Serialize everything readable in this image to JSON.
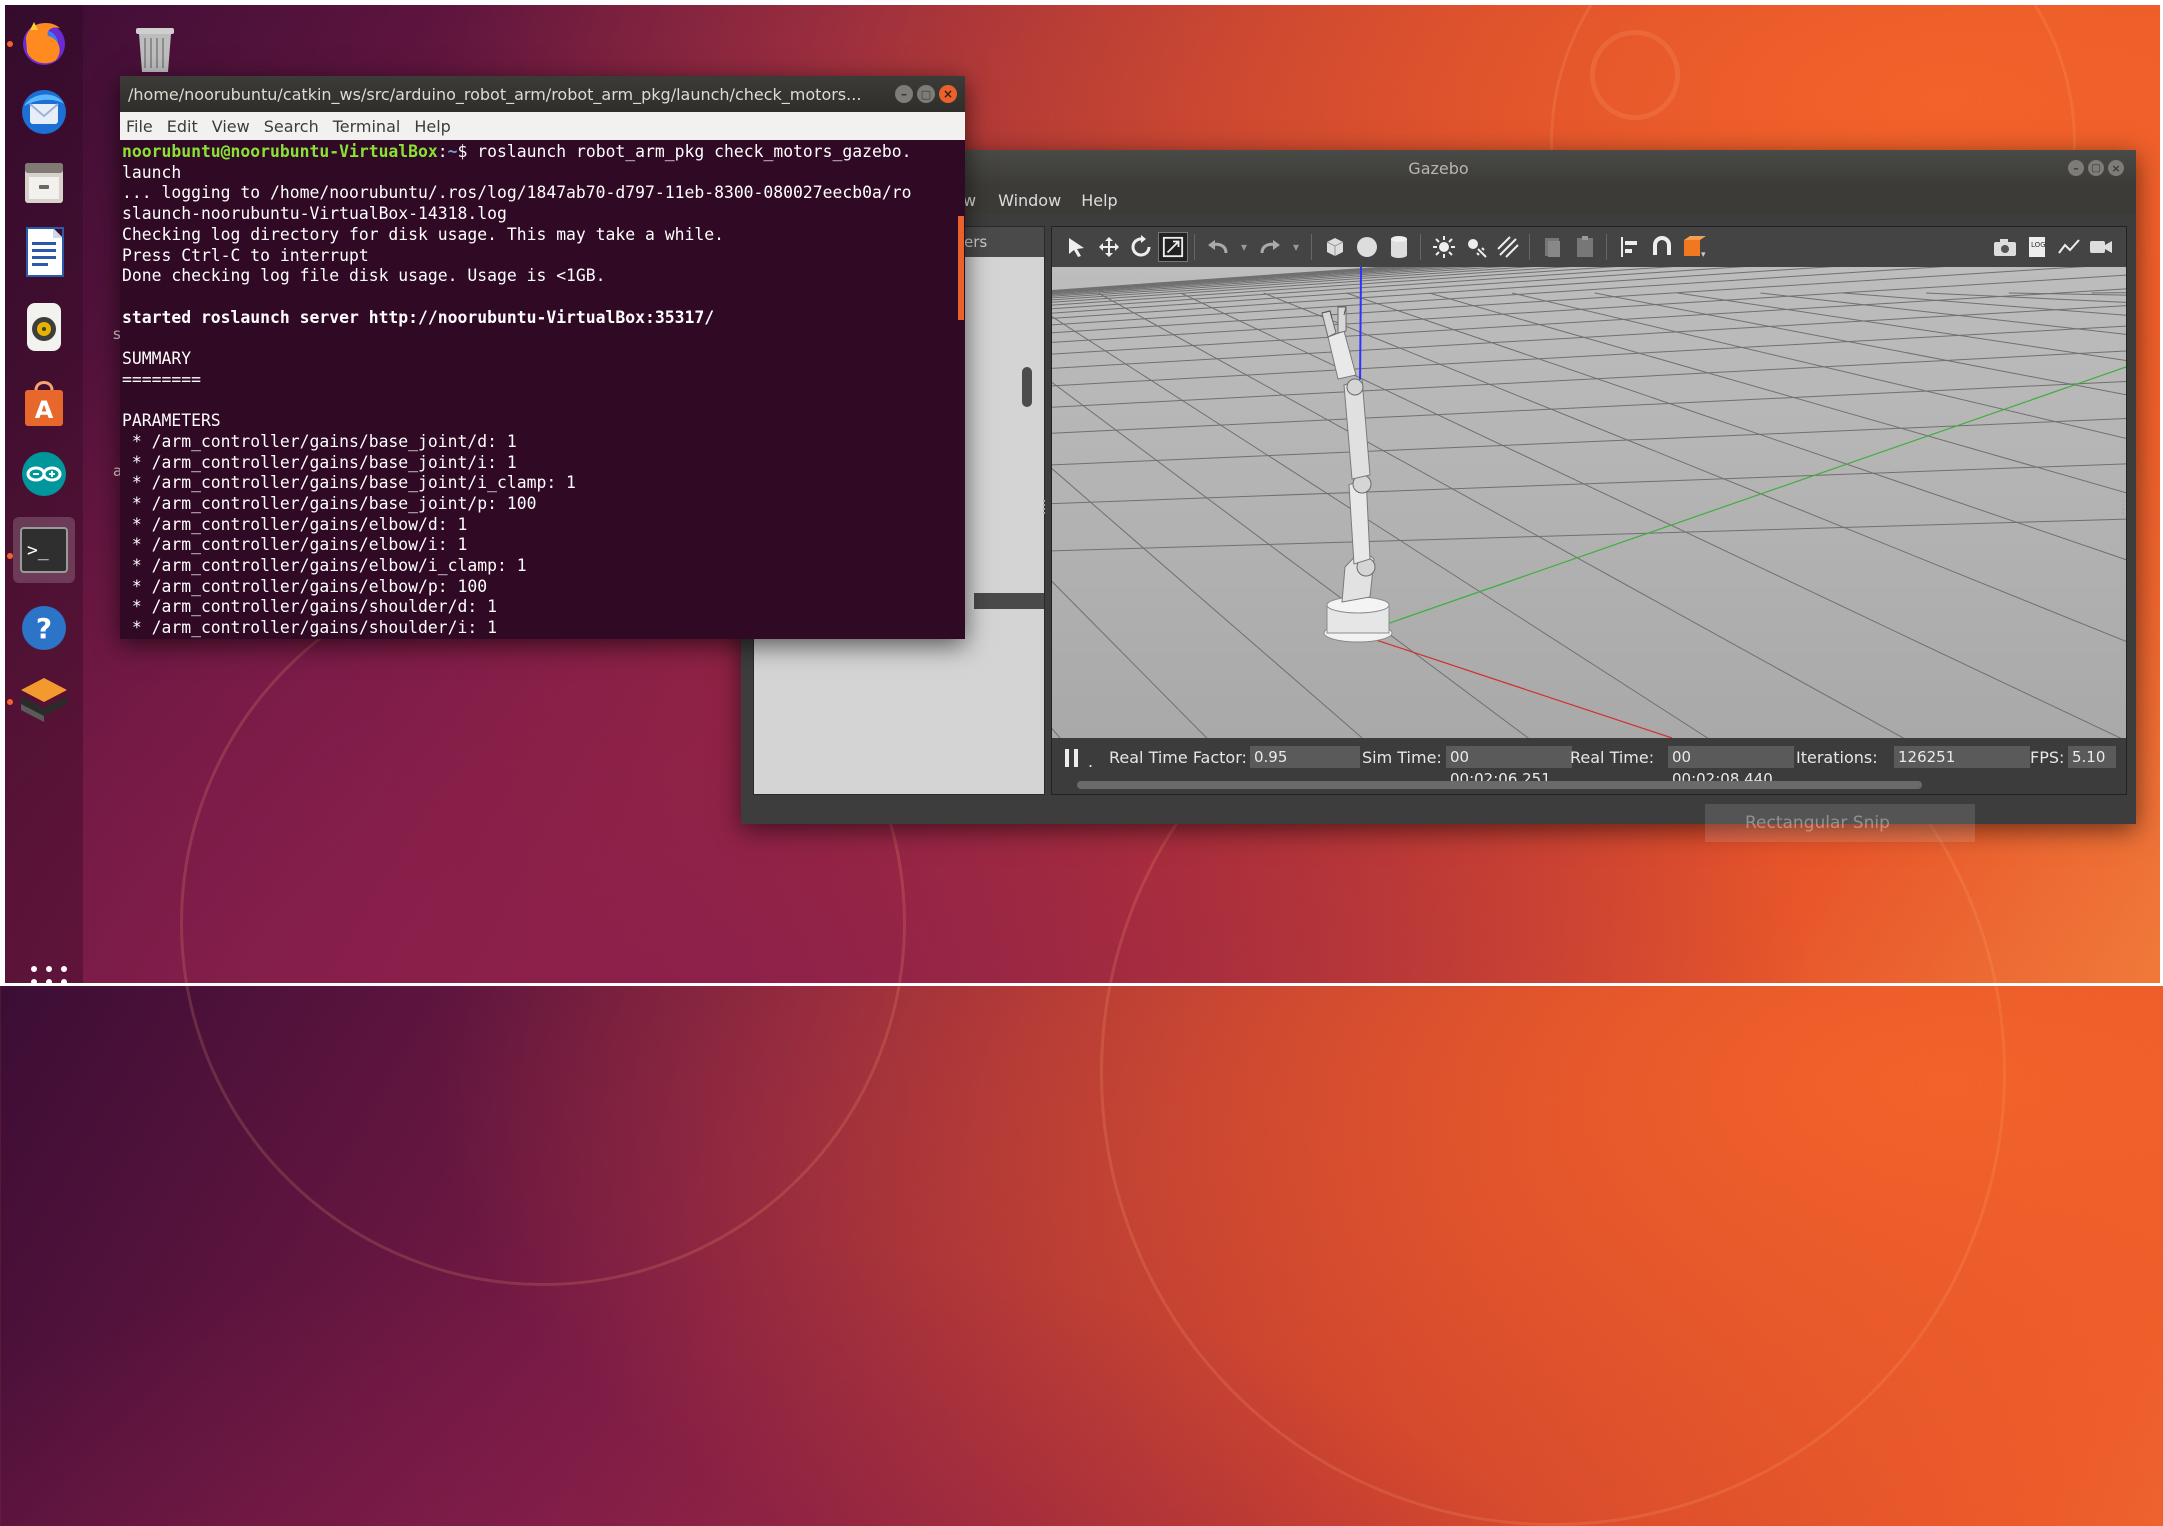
{
  "desktop": {
    "snip_label": "Rectangular Snip",
    "desktop_letters": [
      "s",
      "a"
    ]
  },
  "dock": {
    "items": [
      {
        "name": "Firefox",
        "icon": "firefox-icon"
      },
      {
        "name": "Thunderbird",
        "icon": "thunderbird-icon"
      },
      {
        "name": "Files",
        "icon": "files-icon"
      },
      {
        "name": "LibreOffice Writer",
        "icon": "writer-icon"
      },
      {
        "name": "Rhythmbox",
        "icon": "rhythmbox-icon"
      },
      {
        "name": "Ubuntu Software",
        "icon": "software-icon"
      },
      {
        "name": "Arduino",
        "icon": "arduino-icon"
      },
      {
        "name": "Terminal",
        "icon": "terminal-icon"
      },
      {
        "name": "Help",
        "icon": "help-icon"
      },
      {
        "name": "Gazebo",
        "icon": "gazebo-icon"
      }
    ]
  },
  "terminal": {
    "title": "/home/noorubuntu/catkin_ws/src/arduino_robot_arm/robot_arm_pkg/launch/check_motors...",
    "menu": [
      "File",
      "Edit",
      "View",
      "Search",
      "Terminal",
      "Help"
    ],
    "prompt_user": "noorubuntu@noorubuntu-VirtualBox",
    "prompt_sep": ":",
    "prompt_path": "~",
    "prompt_dollar": "$ ",
    "command_line1": "roslaunch robot_arm_pkg check_motors_gazebo.",
    "lines": [
      "launch",
      "... logging to /home/noorubuntu/.ros/log/1847ab70-d797-11eb-8300-080027eecb0a/ro",
      "slaunch-noorubuntu-VirtualBox-14318.log",
      "Checking log directory for disk usage. This may take a while.",
      "Press Ctrl-C to interrupt",
      "Done checking log file disk usage. Usage is <1GB.",
      "",
      "started roslaunch server http://noorubuntu-VirtualBox:35317/",
      "",
      "SUMMARY",
      "========",
      "",
      "PARAMETERS",
      " * /arm_controller/gains/base_joint/d: 1",
      " * /arm_controller/gains/base_joint/i: 1",
      " * /arm_controller/gains/base_joint/i_clamp: 1",
      " * /arm_controller/gains/base_joint/p: 100",
      " * /arm_controller/gains/elbow/d: 1",
      " * /arm_controller/gains/elbow/i: 1",
      " * /arm_controller/gains/elbow/i_clamp: 1",
      " * /arm_controller/gains/elbow/p: 100",
      " * /arm_controller/gains/shoulder/d: 1",
      " * /arm_controller/gains/shoulder/i: 1"
    ],
    "bold_line_index": 7
  },
  "gazebo": {
    "title": "Gazebo",
    "menu_visible": [
      "w",
      "Window",
      "Help"
    ],
    "left_tab_label": "ers",
    "status": {
      "rtf_label": "Real Time Factor:",
      "rtf_value": "0.95",
      "sim_label": "Sim Time:",
      "sim_value": "00 00:02:06.251",
      "real_label": "Real Time:",
      "real_value": "00 00:02:08.440",
      "iter_label": "Iterations:",
      "iter_value": "126251",
      "fps_label": "FPS:",
      "fps_value": "5.10",
      "step_label": "."
    },
    "colors": {
      "grid_line": "#7a7a7a",
      "x_axis": "#e03030",
      "y_axis": "#40c040",
      "z_axis": "#3030ff",
      "sky": "#b2b2b2"
    }
  }
}
